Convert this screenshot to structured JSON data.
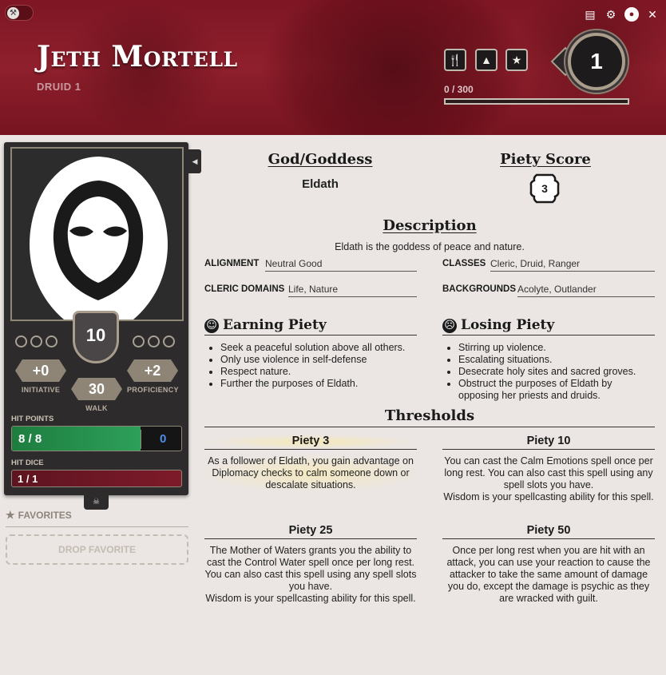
{
  "header": {
    "character_name": "Jeth Mortell",
    "class_level": "DRUID 1",
    "xp_text": "0 / 300",
    "xp_progress": 0,
    "level": "1",
    "quick_buttons": [
      "fork-knife-icon",
      "tent-icon",
      "star-icon"
    ],
    "top_icons": [
      "book-icon",
      "gear-icon",
      "user-circle-icon",
      "close-icon"
    ]
  },
  "sidebar": {
    "proficiency_bonus_shield": "10",
    "initiative": {
      "value": "+0",
      "label": "INITIATIVE"
    },
    "walk": {
      "value": "30",
      "label": "WALK"
    },
    "proficiency": {
      "value": "+2",
      "label": "PROFICIENCY"
    },
    "hit_points": {
      "label": "HIT POINTS",
      "current": "8 / 8",
      "temp": "0",
      "fraction": 1.0
    },
    "hit_dice": {
      "label": "HIT DICE",
      "value": "1 / 1"
    },
    "favorites": {
      "label": "FAVORITES",
      "drop_text": "DROP FAVORITE"
    }
  },
  "deity": {
    "god_heading": "God/Goddess",
    "god_name": "Eldath",
    "piety_heading": "Piety Score",
    "piety_value": "3",
    "description_heading": "Description",
    "description": "Eldath is the goddess of peace and nature.",
    "alignment_label": "ALIGNMENT",
    "alignment": "Neutral Good",
    "classes_label": "CLASSES",
    "classes": "Cleric, Druid, Ranger",
    "domains_label": "CLERIC DOMAINS",
    "domains": "Life, Nature",
    "backgrounds_label": "BACKGROUNDS",
    "backgrounds": "Acolyte, Outlander",
    "earning_heading": "Earning Piety",
    "earning": [
      "Seek a peaceful solution above all others.",
      "Only use violence in self-defense",
      "Respect nature.",
      "Further the purposes of Eldath."
    ],
    "losing_heading": "Losing Piety",
    "losing": [
      "Stirring up violence.",
      "Escalating situations.",
      "Desecrate holy sites and sacred groves.",
      "Obstruct the purposes of Eldath by opposing her priests and druids."
    ],
    "thresholds_heading": "Thresholds",
    "thresholds": [
      {
        "title": "Piety 3",
        "text": "As a follower of Eldath, you gain advantage on Diplomacy checks to calm someone down or descalate situations."
      },
      {
        "title": "Piety 10",
        "text": "You can cast the Calm Emotions spell once per long rest. You can also cast this spell using any spell slots you have.\nWisdom is your spellcasting ability for this spell."
      },
      {
        "title": "Piety 25",
        "text": "The Mother of Waters grants you the ability to cast the Control Water spell once per long rest. You can also cast this spell using any spell slots you have.\nWisdom is your spellcasting ability for this spell."
      },
      {
        "title": "Piety 50",
        "text": "Once per long rest when you are hit with an attack, you can use your reaction to cause the attacker to take the same amount of damage you do, except the damage is psychic as they are wracked with guilt."
      }
    ]
  }
}
